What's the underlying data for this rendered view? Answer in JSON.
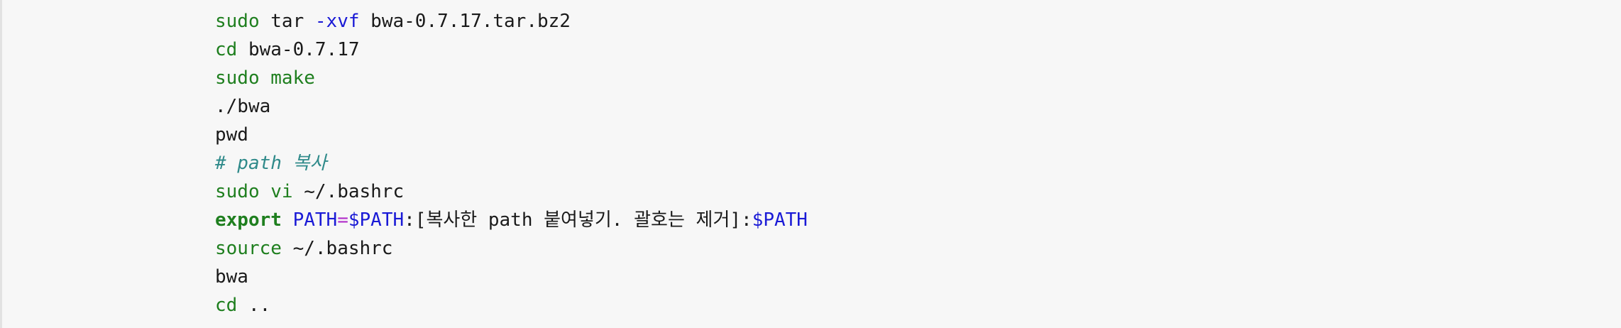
{
  "code_lines": [
    [
      {
        "type": "cmd",
        "text": "sudo"
      },
      {
        "type": "plain",
        "text": " tar "
      },
      {
        "type": "opt",
        "text": "-xvf"
      },
      {
        "type": "plain",
        "text": " bwa-0.7.17.tar.bz2"
      }
    ],
    [
      {
        "type": "cmd",
        "text": "cd"
      },
      {
        "type": "plain",
        "text": " bwa-0.7.17"
      }
    ],
    [
      {
        "type": "cmd",
        "text": "sudo make"
      }
    ],
    [
      {
        "type": "plain",
        "text": "./bwa"
      }
    ],
    [
      {
        "type": "plain",
        "text": "pwd"
      }
    ],
    [
      {
        "type": "comment",
        "text": "# path 복사"
      }
    ],
    [
      {
        "type": "cmd",
        "text": "sudo vi"
      },
      {
        "type": "plain",
        "text": " ~/.bashrc"
      }
    ],
    [
      {
        "type": "kw",
        "text": "export"
      },
      {
        "type": "plain",
        "text": " "
      },
      {
        "type": "var",
        "text": "PATH"
      },
      {
        "type": "op",
        "text": "="
      },
      {
        "type": "var",
        "text": "$PATH"
      },
      {
        "type": "plain",
        "text": ":[복사한 path 붙여넣기. 괄호는 제거]:"
      },
      {
        "type": "var",
        "text": "$PATH"
      }
    ],
    [
      {
        "type": "cmd",
        "text": "source"
      },
      {
        "type": "plain",
        "text": " ~/.bashrc"
      }
    ],
    [
      {
        "type": "plain",
        "text": "bwa"
      }
    ],
    [
      {
        "type": "cmd",
        "text": "cd"
      },
      {
        "type": "plain",
        "text": " .."
      }
    ]
  ],
  "colors": {
    "background": "#f7f7f7",
    "command": "#1f7f1f",
    "option": "#1a1ad6",
    "variable": "#1a1ad6",
    "operator": "#b02cc9",
    "comment": "#2f8a8a",
    "text": "#1a1a1a"
  }
}
